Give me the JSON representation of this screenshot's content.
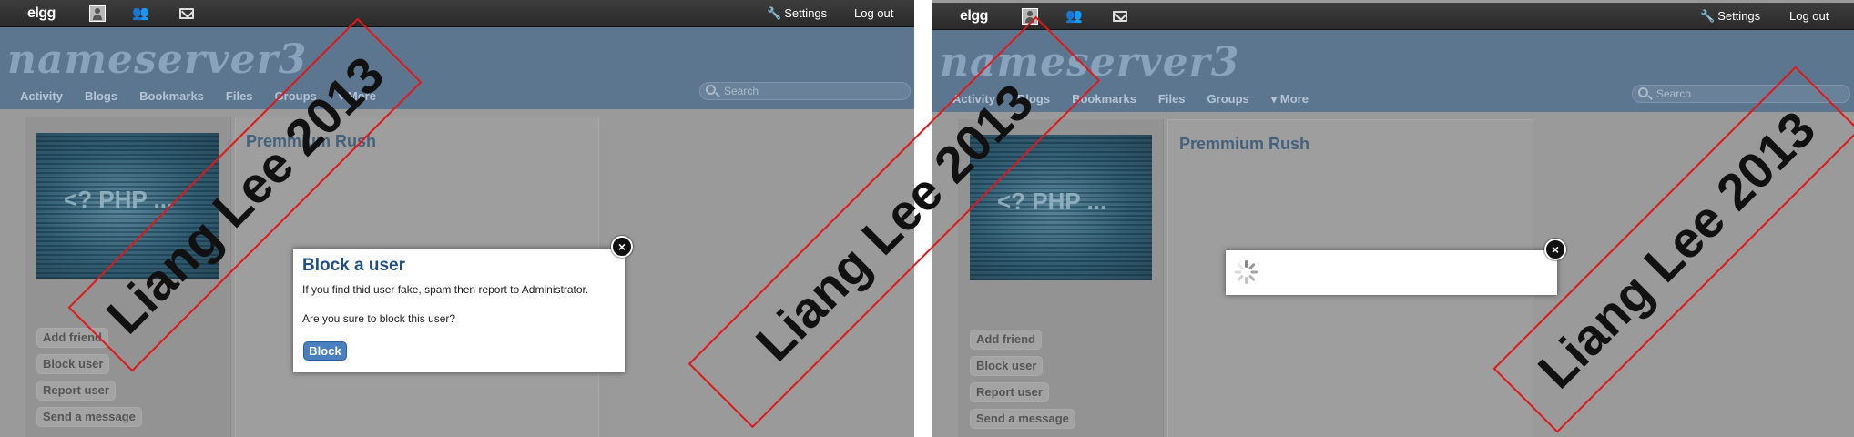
{
  "colors": {
    "topbar": "#2f2f2f",
    "header": "#5d7690",
    "site_name": "#8aa3bd",
    "dialog_title": "#1d4f86",
    "block_button": "#4a7fc0",
    "watermark_border": "#e01818"
  },
  "left": {
    "topbar": {
      "logo": "elgg",
      "settings": "Settings",
      "logout": "Log out"
    },
    "header": {
      "site_name": "nameserver3",
      "nav": [
        "Activity",
        "Blogs",
        "Bookmarks",
        "Files",
        "Groups",
        "▾ More"
      ],
      "search_placeholder": "Search"
    },
    "profile": {
      "avatar_text": "<? PHP ...",
      "title": "Premmium Rush",
      "buttons": [
        "Add friend",
        "Block user",
        "Report user",
        "Send a message"
      ]
    },
    "dialog": {
      "title": "Block a user",
      "message1": "If you find thid user fake, spam then report to Administrator.",
      "message2": "Are you sure to block this user?",
      "button": "Block",
      "close_glyph": "×"
    }
  },
  "right": {
    "topbar": {
      "logo": "elgg",
      "settings": "Settings",
      "logout": "Log out"
    },
    "header": {
      "site_name": "nameserver3",
      "nav": [
        "Activity",
        "Blogs",
        "Bookmarks",
        "Files",
        "Groups",
        "▾ More"
      ],
      "search_placeholder": "Search"
    },
    "profile": {
      "avatar_text": "<? PHP ...",
      "title": "Premmium Rush",
      "buttons": [
        "Add friend",
        "Block user",
        "Report user",
        "Send a message"
      ]
    },
    "loading_close_glyph": "×"
  },
  "watermark": {
    "text": "Liang Lee 2013"
  }
}
